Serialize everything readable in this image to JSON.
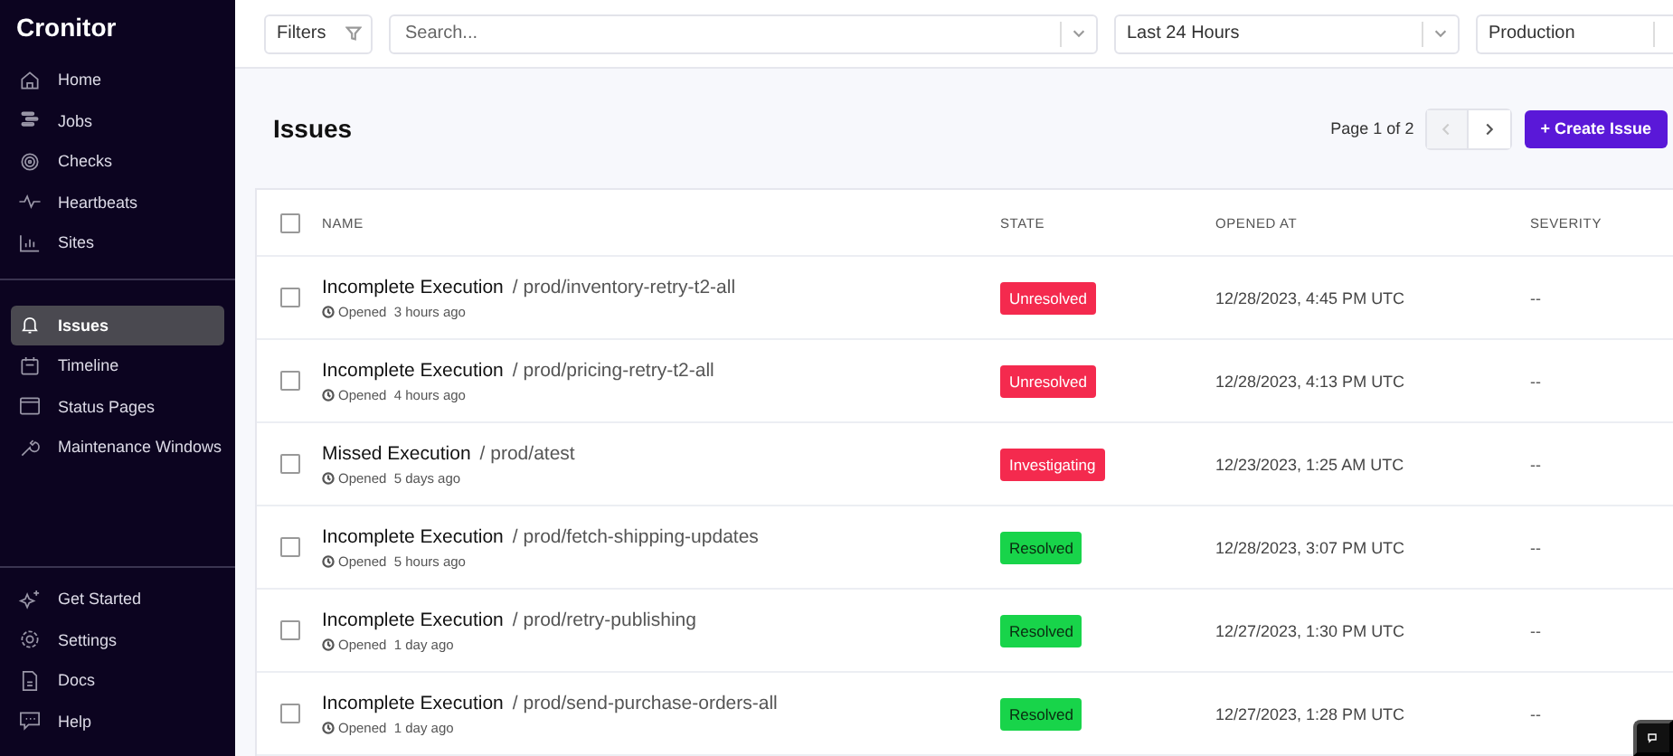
{
  "sidebar": {
    "logo": "Cronitor",
    "items": [
      {
        "label": "Home",
        "selected": false
      },
      {
        "label": "Jobs",
        "selected": false
      },
      {
        "label": "Checks",
        "selected": false
      },
      {
        "label": "Heartbeats",
        "selected": false
      },
      {
        "label": "Sites",
        "selected": false
      }
    ],
    "items_2": [
      {
        "label": "Issues",
        "selected": true
      },
      {
        "label": "Timeline",
        "selected": false
      },
      {
        "label": "Status Pages",
        "selected": false
      },
      {
        "label": "Maintenance Windows",
        "selected": false
      }
    ],
    "footer_items": [
      {
        "label": "Get Started",
        "selected": false
      },
      {
        "label": "Settings",
        "selected": false
      },
      {
        "label": "Docs",
        "selected": false
      },
      {
        "label": "Help",
        "selected": false
      }
    ]
  },
  "toolbar": {
    "filters": "Filters",
    "search": {
      "placeholder": "Search..."
    },
    "time_range": "Last 24 Hours",
    "environment": "Production"
  },
  "page": {
    "title": "Issues",
    "pagination": "Page 1 of 2",
    "create_button": "+ Create Issue"
  },
  "table": {
    "select_all": {
      "checked": false
    },
    "columns": [
      "NAME",
      "STATE",
      "OPENED AT",
      "SEVERITY"
    ],
    "rows": [
      {
        "checked": false,
        "type": "Incomplete Execution",
        "monitor": "/ prod/inventory-retry-t2-all",
        "opened": "Opened  3 hours ago",
        "state": "Unresolved",
        "kind": "unresolved",
        "opened_at": "12/28/2023, 4:45 PM UTC",
        "severity": "--"
      },
      {
        "checked": false,
        "type": "Incomplete Execution",
        "monitor": "/ prod/pricing-retry-t2-all",
        "opened": "Opened  4 hours ago",
        "state": "Unresolved",
        "kind": "unresolved",
        "opened_at": "12/28/2023, 4:13 PM UTC",
        "severity": "--"
      },
      {
        "checked": false,
        "type": "Missed Execution",
        "monitor": "/ prod/atest",
        "opened": "Opened  5 days ago",
        "state": "Investigating",
        "kind": "investigating",
        "opened_at": "12/23/2023, 1:25 AM UTC",
        "severity": "--"
      },
      {
        "checked": false,
        "type": "Incomplete Execution",
        "monitor": "/ prod/fetch-shipping-updates",
        "opened": "Opened  5 hours ago",
        "state": "Resolved",
        "kind": "resolved",
        "opened_at": "12/28/2023, 3:07 PM UTC",
        "severity": "--"
      },
      {
        "checked": false,
        "type": "Incomplete Execution",
        "monitor": "/ prod/retry-publishing",
        "opened": "Opened  1 day ago",
        "state": "Resolved",
        "kind": "resolved",
        "opened_at": "12/27/2023, 1:30 PM UTC",
        "severity": "--"
      },
      {
        "checked": false,
        "type": "Incomplete Execution",
        "monitor": "/ prod/send-purchase-orders-all",
        "opened": "Opened  1 day ago",
        "state": "Resolved",
        "kind": "resolved",
        "opened_at": "12/27/2023, 1:28 PM UTC",
        "severity": "--"
      }
    ]
  }
}
